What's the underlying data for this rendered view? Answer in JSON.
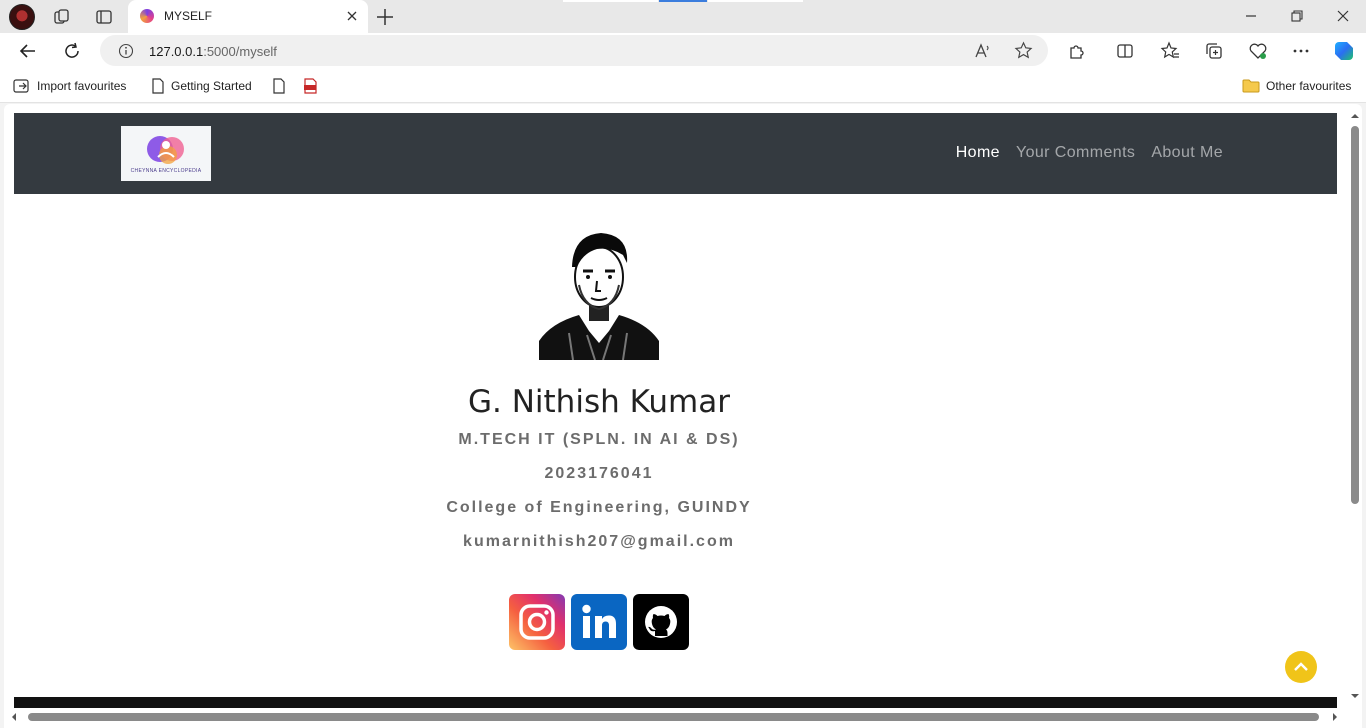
{
  "browser": {
    "tab_title": "MYSELF",
    "url_host": "127.0.0.1",
    "url_path": ":5000/myself",
    "favourites": {
      "import": "Import favourites",
      "getting_started": "Getting Started",
      "other": "Other favourites"
    }
  },
  "site": {
    "logo_text": "CHEYNNA ENCYCLOPEDIA",
    "nav": [
      "Home",
      "Your Comments",
      "About Me"
    ],
    "accent_color": "#f0c419",
    "header_color": "#343a40"
  },
  "profile": {
    "name": "G. Nithish Kumar",
    "degree": "M.TECH IT (SPLN. IN AI & DS)",
    "roll_no": "2023176041",
    "college": "College of Engineering, GUINDY",
    "email": "kumarnithish207@gmail.com"
  },
  "social": {
    "instagram_icon": "instagram-icon",
    "linkedin_icon": "linkedin-icon",
    "github_icon": "github-icon"
  }
}
